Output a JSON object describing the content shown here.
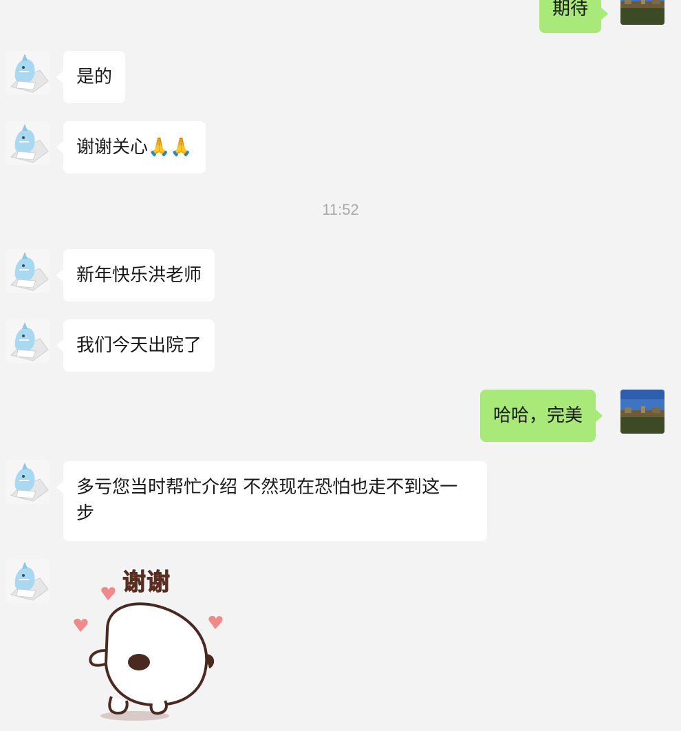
{
  "messages": [
    {
      "id": "m1",
      "side": "outgoing",
      "text": "期待"
    },
    {
      "id": "m2",
      "side": "incoming",
      "text": "是的"
    },
    {
      "id": "m3",
      "side": "incoming",
      "text": "谢谢关心🙏🙏"
    },
    {
      "id": "m4",
      "side": "incoming",
      "text": "新年快乐洪老师"
    },
    {
      "id": "m5",
      "side": "incoming",
      "text": "我们今天出院了"
    },
    {
      "id": "m6",
      "side": "outgoing",
      "text": "哈哈，完美"
    },
    {
      "id": "m7",
      "side": "incoming",
      "text": "多亏您当时帮忙介绍 不然现在恐怕也走不到这一步"
    },
    {
      "id": "m8",
      "side": "incoming",
      "type": "sticker",
      "text": "谢谢"
    }
  ],
  "timestamp": "11:52",
  "colors": {
    "background": "#f3f3f3",
    "incoming_bubble": "#ffffff",
    "outgoing_bubble": "#a9e97a",
    "timestamp": "#a9a9a9"
  },
  "icons": {
    "contact_avatar": "cartoon-shark-avatar",
    "self_avatar": "landscape-photo-avatar",
    "sticker": "white-bun-with-hearts-sticker"
  }
}
